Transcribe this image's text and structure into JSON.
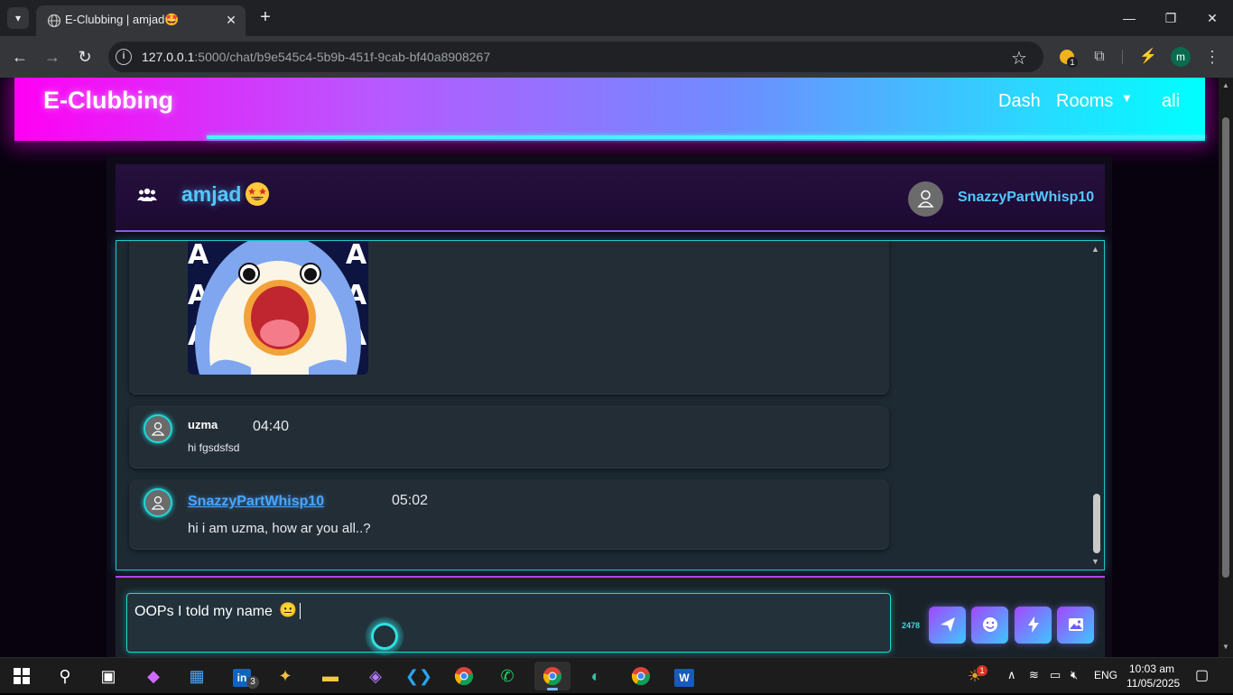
{
  "browser": {
    "tab_title": "E-Clubbing | amjad🤩",
    "url_host": "127.0.0.1",
    "url_path": ":5000/chat/b9e545c4-5b9b-451f-9cab-bf40a8908267",
    "extension_badge": "1",
    "profile_initial": "m"
  },
  "navbar": {
    "brand": "E-Clubbing",
    "links": [
      "Dash",
      "Rooms",
      "ali"
    ]
  },
  "chat": {
    "room_name": "amjad",
    "room_emoji": "🤩",
    "header_user": "SnazzyPartWhisp10",
    "messages": [
      {
        "user": "uzma",
        "time": "04:40",
        "text": "hi fgsdsfsd"
      },
      {
        "user": "SnazzyPartWhisp10",
        "time": "05:02",
        "text": "hi i am uzma, how ar you all..?"
      }
    ]
  },
  "composer": {
    "text": "OOPs I told my name",
    "emoji": "😐",
    "char_count": "2478"
  },
  "taskbar": {
    "linkedin_badge": "3",
    "time": "10:03 am",
    "date": "11/05/2025",
    "lang": "ENG",
    "weather_badge": "1"
  },
  "colors": {
    "accent_cyan": "#1fd6d6",
    "accent_magenta": "#ff00f4",
    "link_blue": "#4aa6ff"
  }
}
